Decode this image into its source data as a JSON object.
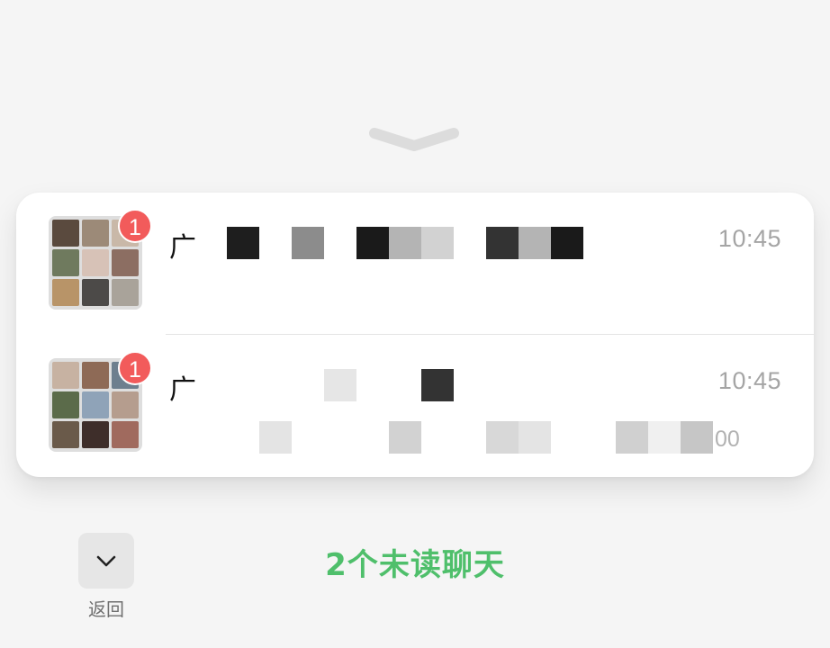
{
  "page": {
    "background_color": "#f5f5f5"
  },
  "collapse_handle": {
    "icon": "chevron-down-icon"
  },
  "chats": [
    {
      "title_visible": "广",
      "unread_count": "1",
      "time": "10:45",
      "preview_visible": "",
      "avatar_type": "group-photo-grid",
      "title_redacted": true,
      "preview_redacted": true
    },
    {
      "title_visible": "广",
      "unread_count": "1",
      "time": "10:45",
      "preview_visible": "00",
      "avatar_type": "group-photo-grid",
      "title_redacted": true,
      "preview_redacted": true
    }
  ],
  "footer": {
    "back_icon": "chevron-down-icon",
    "back_label": "返回",
    "unread_summary": "2个未读聊天"
  },
  "colors": {
    "badge": "#f25b5b",
    "accent_green": "#4fbf6b",
    "time_text": "#a5a5a5",
    "card_background": "#ffffff"
  }
}
